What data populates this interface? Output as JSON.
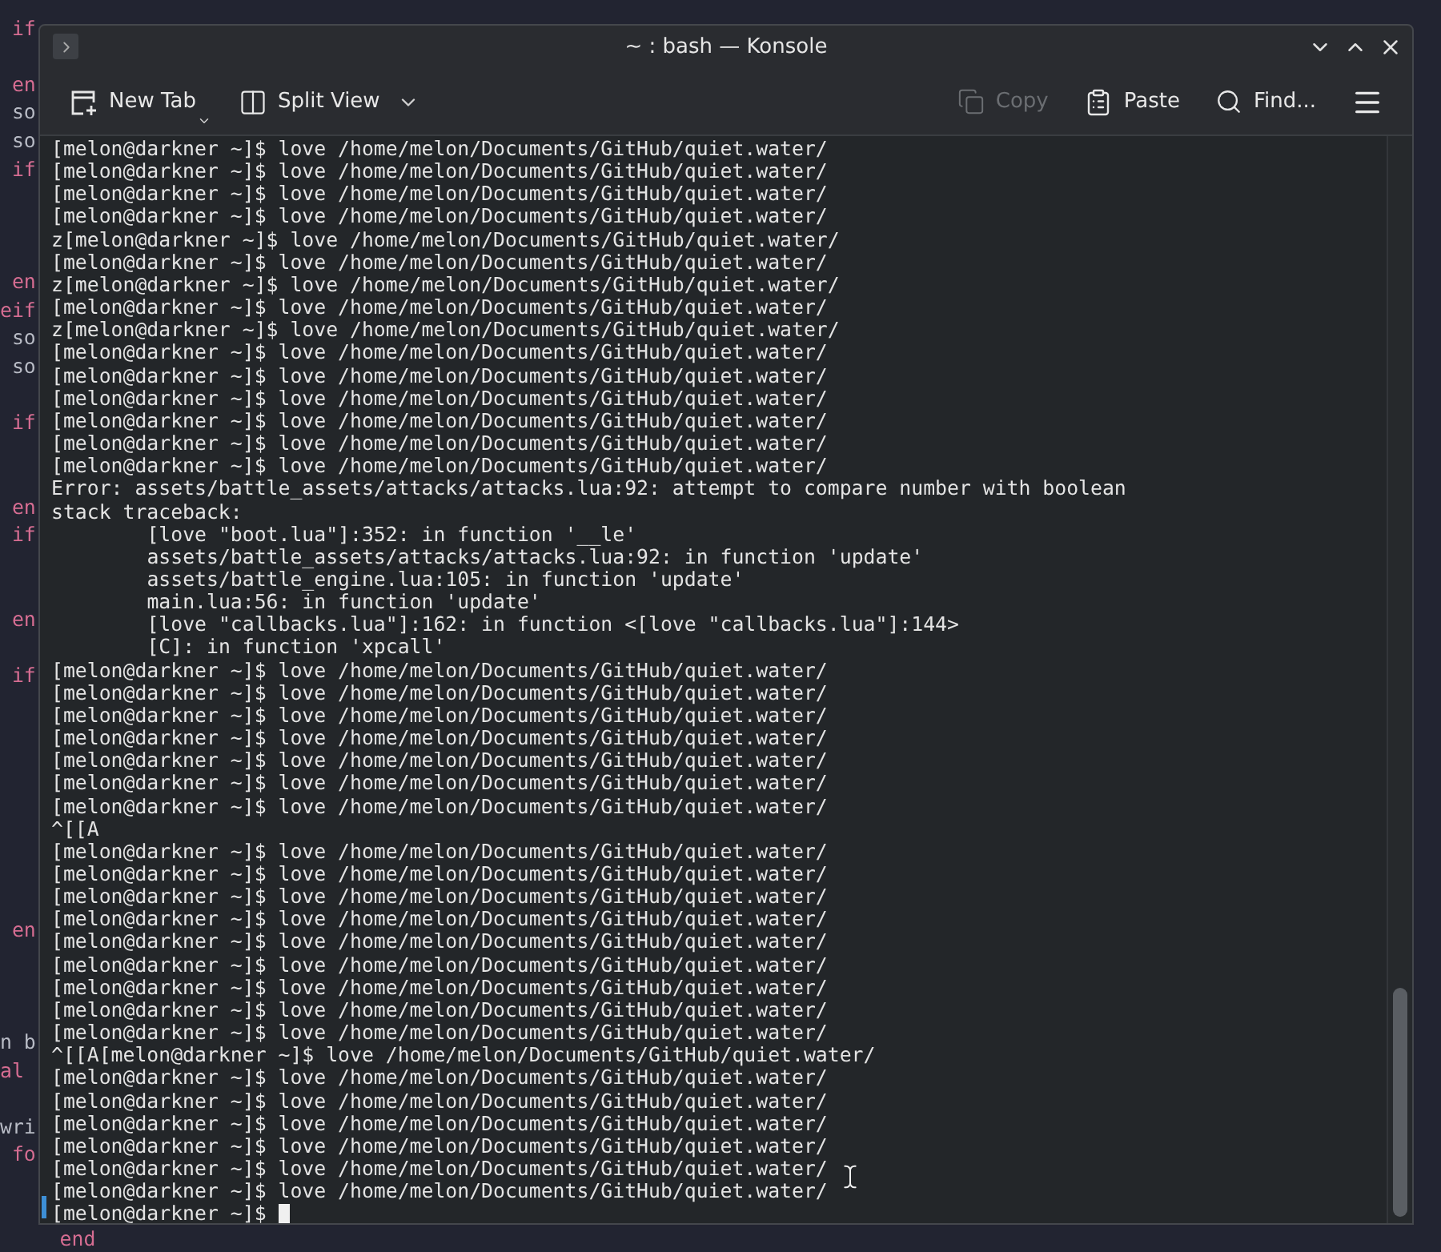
{
  "editor": {
    "lines": [
      {
        "kind": "blank"
      },
      {
        "kind": "keyword",
        "text": " if"
      },
      {
        "kind": "blank"
      },
      {
        "kind": "keyword",
        "text": " en"
      },
      {
        "kind": "plain",
        "text": " so"
      },
      {
        "kind": "plain",
        "text": " so"
      },
      {
        "kind": "keyword",
        "text": " if"
      },
      {
        "kind": "blank"
      },
      {
        "kind": "blank"
      },
      {
        "kind": "blank"
      },
      {
        "kind": "keyword",
        "text": " en"
      },
      {
        "kind": "keyword",
        "text": "eif"
      },
      {
        "kind": "plain",
        "text": " so"
      },
      {
        "kind": "plain",
        "text": " so"
      },
      {
        "kind": "blank"
      },
      {
        "kind": "keyword",
        "text": " if"
      },
      {
        "kind": "blank"
      },
      {
        "kind": "blank"
      },
      {
        "kind": "keyword",
        "text": " en"
      },
      {
        "kind": "keyword",
        "text": " if"
      },
      {
        "kind": "blank"
      },
      {
        "kind": "blank"
      },
      {
        "kind": "keyword",
        "text": " en"
      },
      {
        "kind": "blank"
      },
      {
        "kind": "keyword",
        "text": " if"
      },
      {
        "kind": "blank"
      },
      {
        "kind": "blank"
      },
      {
        "kind": "blank"
      },
      {
        "kind": "blank"
      },
      {
        "kind": "blank"
      },
      {
        "kind": "blank"
      },
      {
        "kind": "blank"
      },
      {
        "kind": "blank"
      },
      {
        "kind": "keyword",
        "text": " en"
      },
      {
        "kind": "blank"
      },
      {
        "kind": "blank"
      },
      {
        "kind": "blank"
      },
      {
        "kind": "plain",
        "text": "n b"
      },
      {
        "kind": "keyword",
        "text": "al"
      },
      {
        "kind": "blank"
      },
      {
        "kind": "plain",
        "text": "wri"
      },
      {
        "kind": "keyword",
        "text": " fo"
      },
      {
        "kind": "blank"
      },
      {
        "kind": "blank"
      },
      {
        "kind": "keyword",
        "text": "     end"
      }
    ]
  },
  "window": {
    "title": "~ : bash — Konsole"
  },
  "toolbar": {
    "items": [
      {
        "kind": "new-tab",
        "label": "New Tab",
        "disabled": false
      },
      {
        "kind": "split",
        "label": "Split View",
        "disabled": false
      },
      {
        "kind": "copy",
        "label": "Copy",
        "disabled": true
      },
      {
        "kind": "paste",
        "label": "Paste",
        "disabled": false
      },
      {
        "kind": "find",
        "label": "Find...",
        "disabled": false
      },
      {
        "kind": "menu",
        "disabled": false
      }
    ]
  },
  "terminal": {
    "lines": [
      "[melon@darkner ~]$ love /home/melon/Documents/GitHub/quiet.water/",
      "[melon@darkner ~]$ love /home/melon/Documents/GitHub/quiet.water/",
      "[melon@darkner ~]$ love /home/melon/Documents/GitHub/quiet.water/",
      "[melon@darkner ~]$ love /home/melon/Documents/GitHub/quiet.water/",
      "z[melon@darkner ~]$ love /home/melon/Documents/GitHub/quiet.water/",
      "[melon@darkner ~]$ love /home/melon/Documents/GitHub/quiet.water/",
      "z[melon@darkner ~]$ love /home/melon/Documents/GitHub/quiet.water/",
      "[melon@darkner ~]$ love /home/melon/Documents/GitHub/quiet.water/",
      "z[melon@darkner ~]$ love /home/melon/Documents/GitHub/quiet.water/",
      "[melon@darkner ~]$ love /home/melon/Documents/GitHub/quiet.water/",
      "[melon@darkner ~]$ love /home/melon/Documents/GitHub/quiet.water/",
      "[melon@darkner ~]$ love /home/melon/Documents/GitHub/quiet.water/",
      "[melon@darkner ~]$ love /home/melon/Documents/GitHub/quiet.water/",
      "[melon@darkner ~]$ love /home/melon/Documents/GitHub/quiet.water/",
      "[melon@darkner ~]$ love /home/melon/Documents/GitHub/quiet.water/",
      "Error: assets/battle_assets/attacks/attacks.lua:92: attempt to compare number with boolean",
      "stack traceback:",
      "\t[love \"boot.lua\"]:352: in function '__le'",
      "\tassets/battle_assets/attacks/attacks.lua:92: in function 'update'",
      "\tassets/battle_engine.lua:105: in function 'update'",
      "\tmain.lua:56: in function 'update'",
      "\t[love \"callbacks.lua\"]:162: in function <[love \"callbacks.lua\"]:144>",
      "\t[C]: in function 'xpcall'",
      "[melon@darkner ~]$ love /home/melon/Documents/GitHub/quiet.water/",
      "[melon@darkner ~]$ love /home/melon/Documents/GitHub/quiet.water/",
      "[melon@darkner ~]$ love /home/melon/Documents/GitHub/quiet.water/",
      "[melon@darkner ~]$ love /home/melon/Documents/GitHub/quiet.water/",
      "[melon@darkner ~]$ love /home/melon/Documents/GitHub/quiet.water/",
      "[melon@darkner ~]$ love /home/melon/Documents/GitHub/quiet.water/",
      "[melon@darkner ~]$ love /home/melon/Documents/GitHub/quiet.water/",
      "^[[A",
      "[melon@darkner ~]$ love /home/melon/Documents/GitHub/quiet.water/",
      "[melon@darkner ~]$ love /home/melon/Documents/GitHub/quiet.water/",
      "[melon@darkner ~]$ love /home/melon/Documents/GitHub/quiet.water/",
      "[melon@darkner ~]$ love /home/melon/Documents/GitHub/quiet.water/",
      "[melon@darkner ~]$ love /home/melon/Documents/GitHub/quiet.water/",
      "[melon@darkner ~]$ love /home/melon/Documents/GitHub/quiet.water/",
      "[melon@darkner ~]$ love /home/melon/Documents/GitHub/quiet.water/",
      "[melon@darkner ~]$ love /home/melon/Documents/GitHub/quiet.water/",
      "[melon@darkner ~]$ love /home/melon/Documents/GitHub/quiet.water/",
      "^[[A[melon@darkner ~]$ love /home/melon/Documents/GitHub/quiet.water/",
      "[melon@darkner ~]$ love /home/melon/Documents/GitHub/quiet.water/",
      "[melon@darkner ~]$ love /home/melon/Documents/GitHub/quiet.water/",
      "[melon@darkner ~]$ love /home/melon/Documents/GitHub/quiet.water/",
      "[melon@darkner ~]$ love /home/melon/Documents/GitHub/quiet.water/",
      "[melon@darkner ~]$ love /home/melon/Documents/GitHub/quiet.water/",
      "[melon@darkner ~]$ love /home/melon/Documents/GitHub/quiet.water/"
    ],
    "prompt": "[melon@darkner ~]$"
  }
}
